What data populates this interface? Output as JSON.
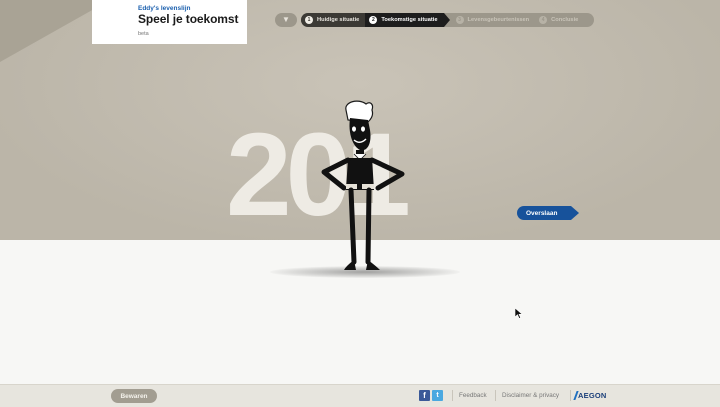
{
  "header": {
    "subtitle": "Eddy's levenslijn",
    "title": "Speel je toekomst",
    "badge": "beta"
  },
  "nav": {
    "home_icon": "trophy-icon",
    "steps": [
      {
        "number": "1",
        "label": "Huidige situatie",
        "state": "done"
      },
      {
        "number": "2",
        "label": "Toekomstige situatie",
        "state": "active"
      },
      {
        "number": "3",
        "label": "Levensgebeurtenissen",
        "state": "future"
      },
      {
        "number": "4",
        "label": "Conclusie",
        "state": "future"
      }
    ]
  },
  "stage": {
    "year_text": "201",
    "skip_label": "Overslaan"
  },
  "footer": {
    "save_label": "Bewaren",
    "facebook_icon": "f",
    "twitter_icon": "t",
    "feedback_label": "Feedback",
    "disclaimer_label": "Disclaimer & privacy",
    "brand": "AEGON"
  },
  "colors": {
    "stage_bg": "#c1bbae",
    "accent_blue": "#17529b",
    "nav_active": "#1d1d1d"
  }
}
